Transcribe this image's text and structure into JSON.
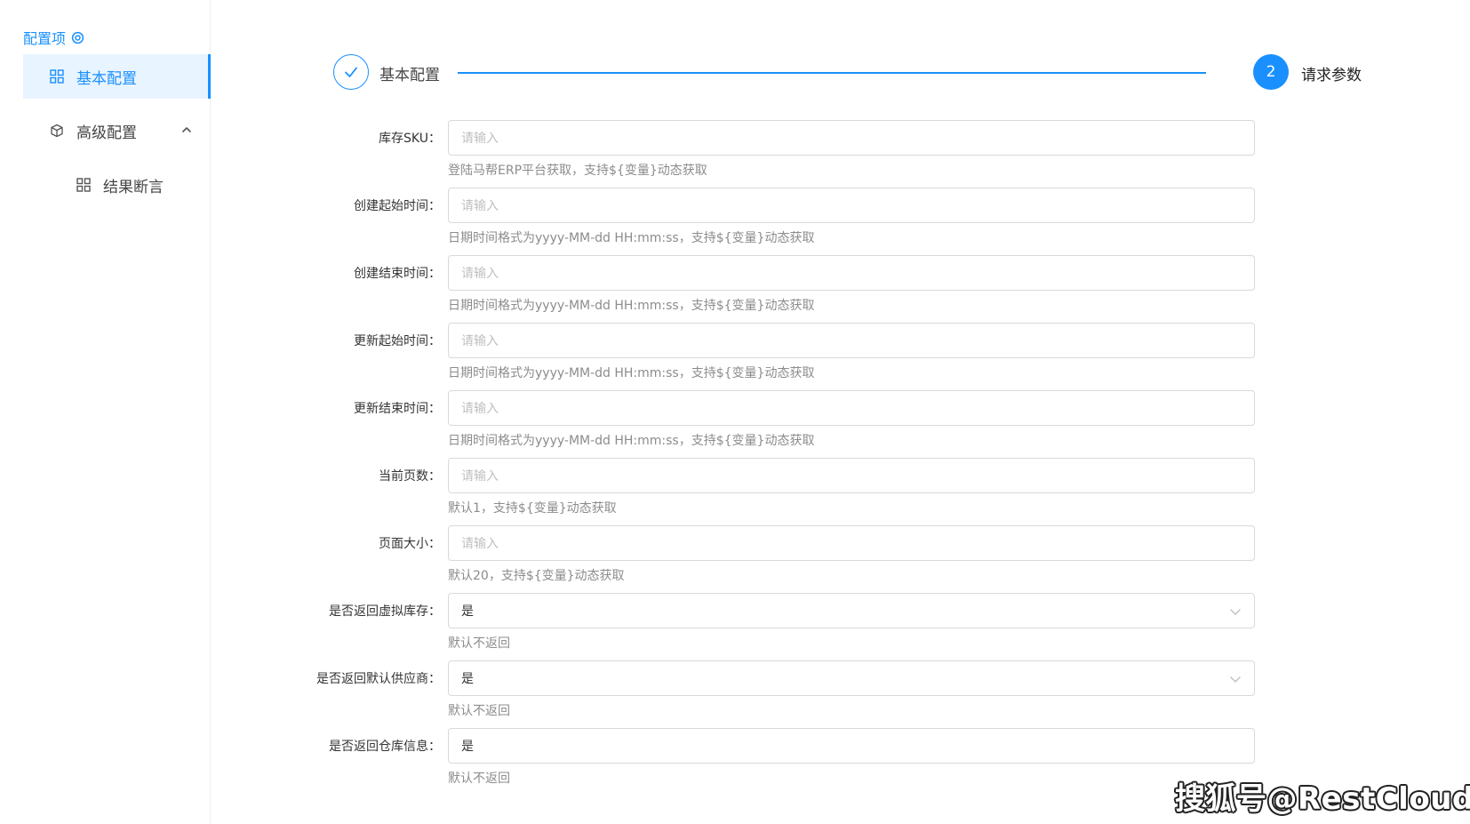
{
  "sidebar": {
    "title": "配置项",
    "title_icon": "settings-target-icon",
    "items": [
      {
        "label": "基本配置",
        "icon": "grid-icon",
        "active": true
      },
      {
        "label": "高级配置",
        "icon": "cube-icon",
        "expanded": true
      },
      {
        "label": "结果断言",
        "icon": "grid-icon",
        "child": true
      }
    ]
  },
  "steps": [
    {
      "label": "基本配置",
      "status": "done"
    },
    {
      "number": "2",
      "label": "请求参数",
      "status": "current"
    }
  ],
  "form": {
    "fields": [
      {
        "label": "库存SKU：",
        "placeholder": "请输入",
        "help": "登陆马帮ERP平台获取，支持${变量}动态获取"
      },
      {
        "label": "创建起始时间：",
        "placeholder": "请输入",
        "help": "日期时间格式为yyyy-MM-dd HH:mm:ss，支持${变量}动态获取"
      },
      {
        "label": "创建结束时间：",
        "placeholder": "请输入",
        "help": "日期时间格式为yyyy-MM-dd HH:mm:ss，支持${变量}动态获取"
      },
      {
        "label": "更新起始时间：",
        "placeholder": "请输入",
        "help": "日期时间格式为yyyy-MM-dd HH:mm:ss，支持${变量}动态获取"
      },
      {
        "label": "更新结束时间：",
        "placeholder": "请输入",
        "help": "日期时间格式为yyyy-MM-dd HH:mm:ss，支持${变量}动态获取"
      },
      {
        "label": "当前页数：",
        "placeholder": "请输入",
        "help": "默认1，支持${变量}动态获取"
      },
      {
        "label": "页面大小：",
        "placeholder": "请输入",
        "help": "默认20，支持${变量}动态获取"
      },
      {
        "label": "是否返回虚拟库存：",
        "value": "是",
        "help": "默认不返回",
        "type": "select"
      },
      {
        "label": "是否返回默认供应商：",
        "value": "是",
        "help": "默认不返回",
        "type": "select"
      },
      {
        "label": "是否返回仓库信息：",
        "value": "是",
        "help": "默认不返回",
        "type": "select"
      }
    ]
  },
  "watermark": "搜狐号@RestCloud",
  "colors": {
    "primary": "#1a90ff",
    "active_bg": "#e8f4ff",
    "border": "#d9d9d9"
  }
}
